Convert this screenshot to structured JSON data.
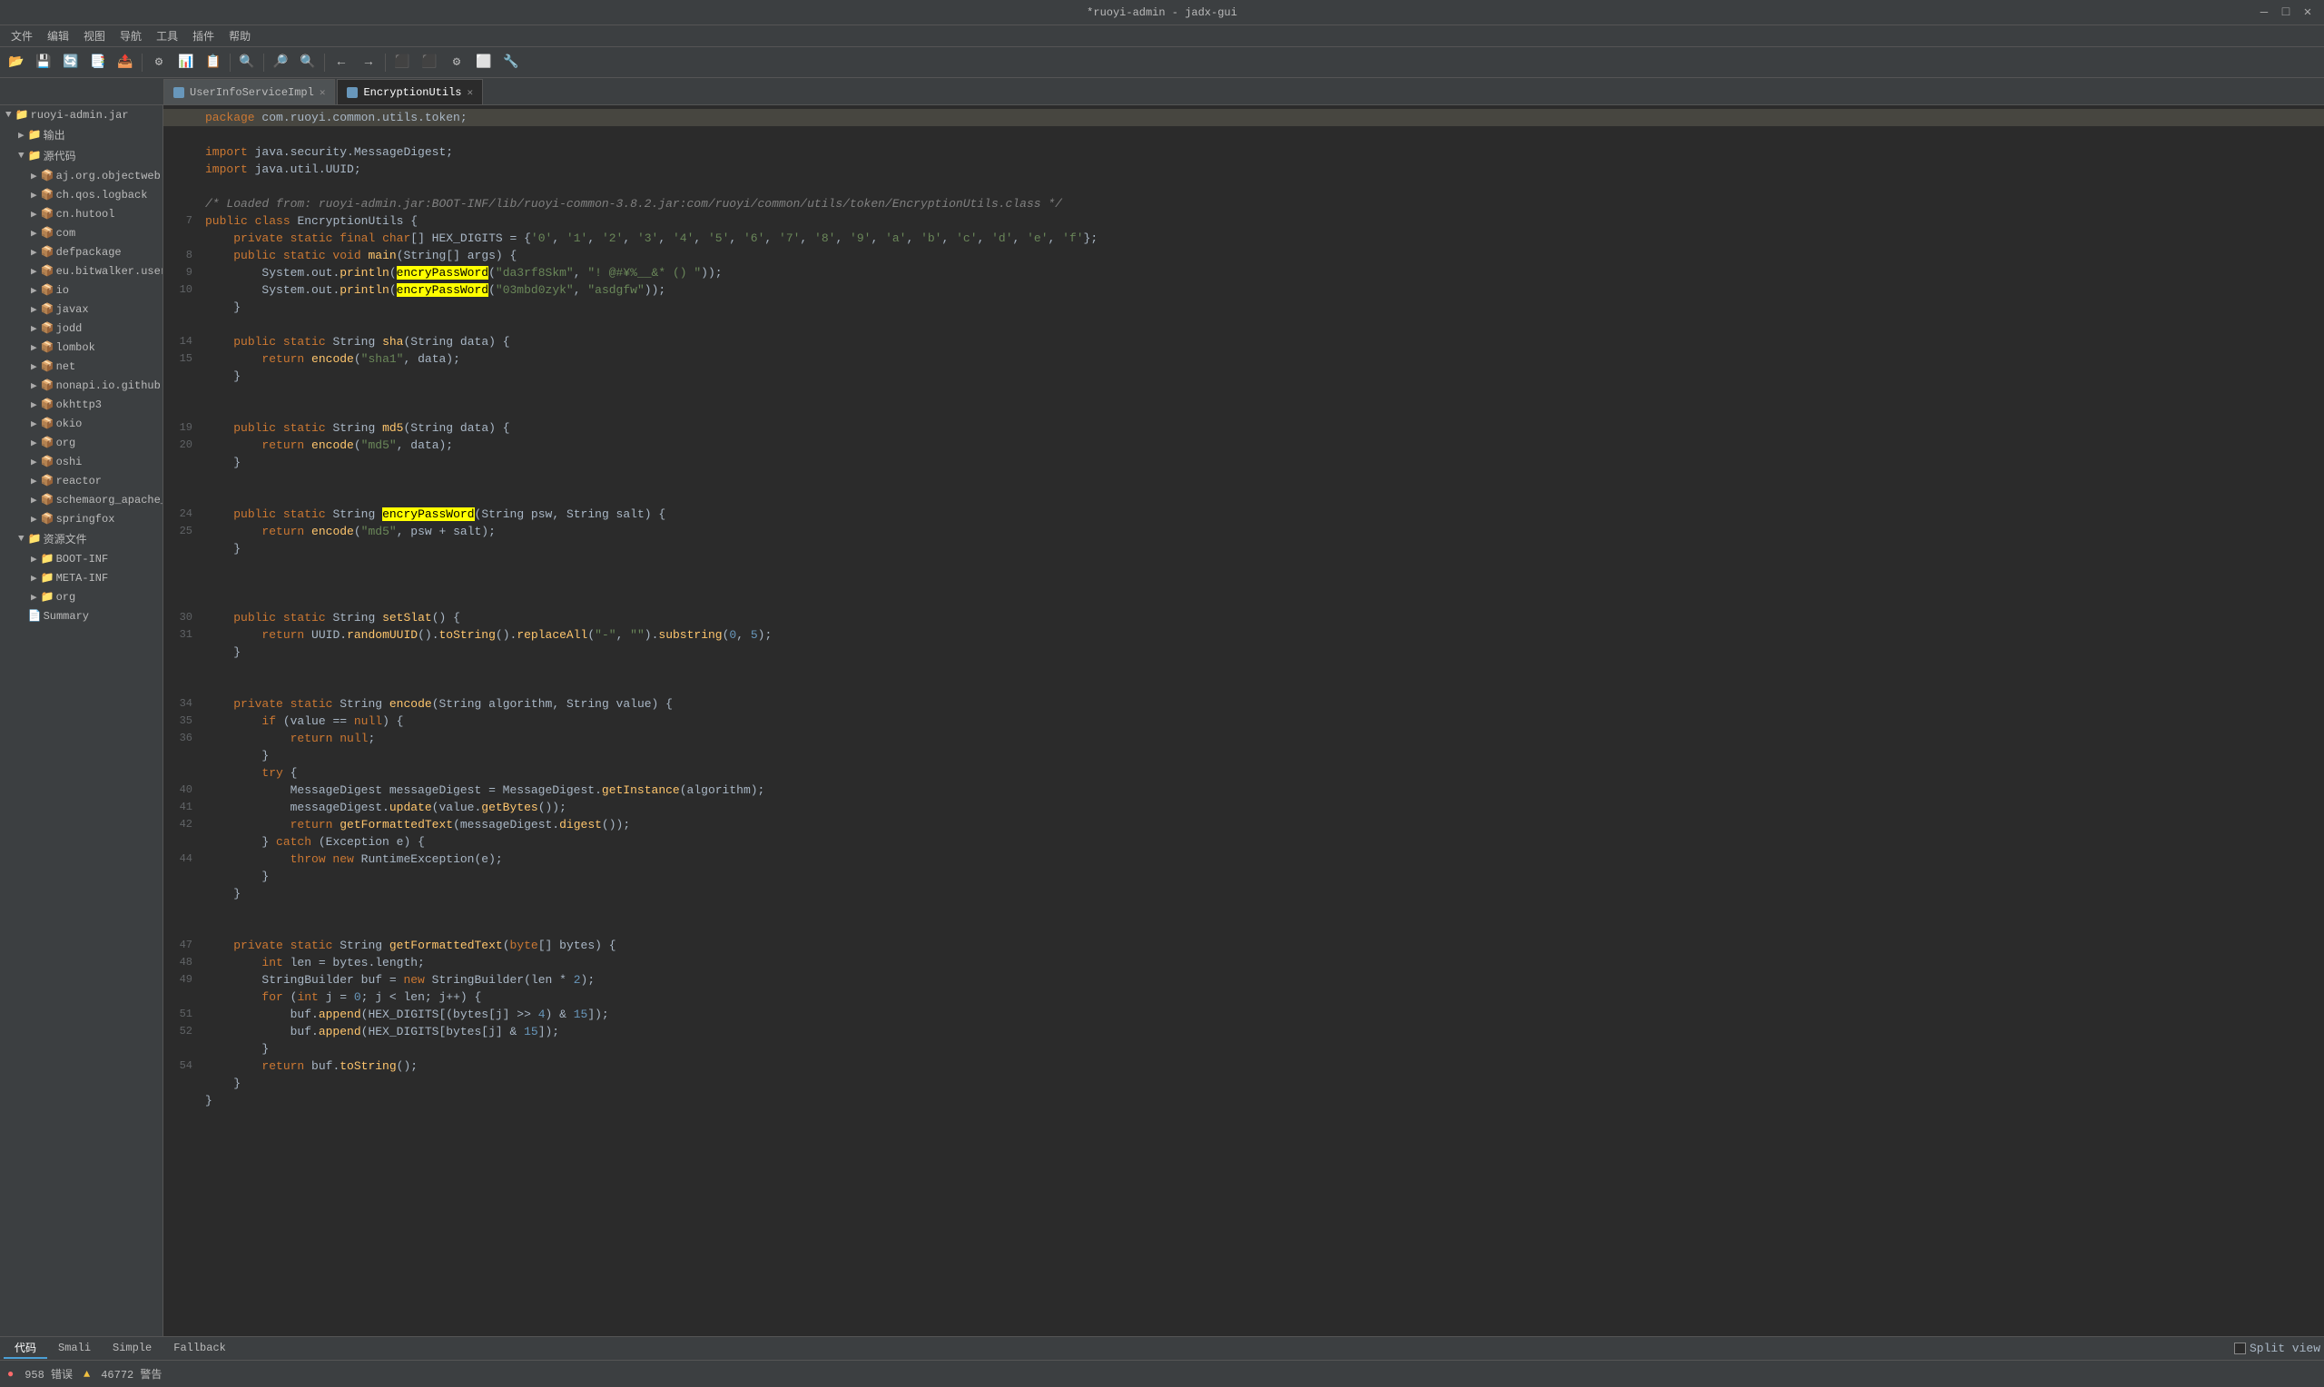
{
  "titlebar": {
    "title": "*ruoyi-admin - jadx-gui",
    "min": "—",
    "max": "□",
    "close": "✕"
  },
  "menubar": {
    "items": [
      "文件",
      "编辑",
      "视图",
      "导航",
      "工具",
      "插件",
      "帮助"
    ]
  },
  "tabs": [
    {
      "id": "userinfoserviceimpl",
      "label": "UserInfoServiceImpl",
      "icon_color": "#6897bb",
      "active": false
    },
    {
      "id": "encryptionutils",
      "label": "EncryptionUtils",
      "icon_color": "#6897bb",
      "active": true
    }
  ],
  "sidebar": {
    "title": "ruoyi-admin.jar",
    "items": [
      {
        "id": "output",
        "label": "输出",
        "level": 1,
        "expanded": false,
        "icon": "folder"
      },
      {
        "id": "sourcecode",
        "label": "源代码",
        "level": 1,
        "expanded": true,
        "icon": "folder"
      },
      {
        "id": "aj",
        "label": "aj.org.objectweb...",
        "level": 2,
        "expanded": false,
        "icon": "package"
      },
      {
        "id": "ch",
        "label": "ch.qos.logback",
        "level": 2,
        "expanded": false,
        "icon": "package"
      },
      {
        "id": "cn",
        "label": "cn.hutool",
        "level": 2,
        "expanded": false,
        "icon": "package"
      },
      {
        "id": "com",
        "label": "com",
        "level": 2,
        "expanded": false,
        "icon": "package"
      },
      {
        "id": "defpackage",
        "label": "defpackage",
        "level": 2,
        "expanded": false,
        "icon": "package"
      },
      {
        "id": "eu",
        "label": "eu.bitwalker.user...",
        "level": 2,
        "expanded": false,
        "icon": "package"
      },
      {
        "id": "io",
        "label": "io",
        "level": 2,
        "expanded": false,
        "icon": "package"
      },
      {
        "id": "javax",
        "label": "javax",
        "level": 2,
        "expanded": false,
        "icon": "package"
      },
      {
        "id": "jodd",
        "label": "jodd",
        "level": 2,
        "expanded": false,
        "icon": "package"
      },
      {
        "id": "lombok",
        "label": "lombok",
        "level": 2,
        "expanded": false,
        "icon": "package"
      },
      {
        "id": "net",
        "label": "net",
        "level": 2,
        "expanded": false,
        "icon": "package"
      },
      {
        "id": "nonapi",
        "label": "nonapi.io.github...",
        "level": 2,
        "expanded": false,
        "icon": "package"
      },
      {
        "id": "okhttp3",
        "label": "okhttp3",
        "level": 2,
        "expanded": false,
        "icon": "package"
      },
      {
        "id": "okio",
        "label": "okio",
        "level": 2,
        "expanded": false,
        "icon": "package"
      },
      {
        "id": "org",
        "label": "org",
        "level": 2,
        "expanded": false,
        "icon": "package"
      },
      {
        "id": "oshi",
        "label": "oshi",
        "level": 2,
        "expanded": false,
        "icon": "package"
      },
      {
        "id": "reactor",
        "label": "reactor",
        "level": 2,
        "expanded": false,
        "icon": "package"
      },
      {
        "id": "schemaorg",
        "label": "schemaorg_apache_...",
        "level": 2,
        "expanded": false,
        "icon": "package"
      },
      {
        "id": "springfox",
        "label": "springfox",
        "level": 2,
        "expanded": false,
        "icon": "package"
      },
      {
        "id": "resources",
        "label": "资源文件",
        "level": 1,
        "expanded": true,
        "icon": "folder"
      },
      {
        "id": "bootinf",
        "label": "BOOT-INF",
        "level": 2,
        "expanded": false,
        "icon": "folder"
      },
      {
        "id": "metainf",
        "label": "META-INF",
        "level": 2,
        "expanded": false,
        "icon": "folder"
      },
      {
        "id": "org2",
        "label": "org",
        "level": 2,
        "expanded": false,
        "icon": "folder"
      },
      {
        "id": "summary",
        "label": "Summary",
        "level": 1,
        "icon": "file"
      }
    ]
  },
  "code": {
    "package_line": "package com.ruoyi.common.utils.token;",
    "lines": [
      {
        "num": "",
        "content": ""
      },
      {
        "num": "",
        "content": ""
      },
      {
        "num": "",
        "content": ""
      },
      {
        "num": "",
        "content": ""
      },
      {
        "num": "",
        "content": ""
      },
      {
        "num": "",
        "content": ""
      },
      {
        "num": "7",
        "content": "public class EncryptionUtils {"
      },
      {
        "num": "",
        "content": "    private static final char[] HEX_DIGITS = {'0', '1', '2', '3', '4', '5', '6', '7', '8', '9', 'a', 'b', 'c', 'd', 'e', 'f'};"
      },
      {
        "num": "8",
        "content": "    public static void main(String[] args) {"
      },
      {
        "num": "9",
        "content": "        System.out.println(encryPassWord(\"da3rf8Skm\", \"! @#¥%__&* () \"));"
      },
      {
        "num": "10",
        "content": "        System.out.println(encryPassWord(\"03mbd0zyk\", \"asdgfw\"));"
      },
      {
        "num": "",
        "content": "    }"
      },
      {
        "num": "",
        "content": ""
      },
      {
        "num": "14",
        "content": "    public static String sha(String data) {"
      },
      {
        "num": "15",
        "content": "        return encode(\"sha1\", data);"
      },
      {
        "num": "",
        "content": "    }"
      },
      {
        "num": "",
        "content": ""
      },
      {
        "num": "",
        "content": ""
      },
      {
        "num": "19",
        "content": "    public static String md5(String data) {"
      },
      {
        "num": "20",
        "content": "        return encode(\"md5\", data);"
      },
      {
        "num": "",
        "content": "    }"
      },
      {
        "num": "",
        "content": ""
      },
      {
        "num": "",
        "content": ""
      },
      {
        "num": "24",
        "content": "    public static String encryPassWord(String psw, String salt) {"
      },
      {
        "num": "25",
        "content": "        return encode(\"md5\", psw + salt);"
      },
      {
        "num": "",
        "content": "    }"
      },
      {
        "num": "",
        "content": ""
      },
      {
        "num": "",
        "content": ""
      },
      {
        "num": "",
        "content": ""
      },
      {
        "num": "30",
        "content": "    public static String setSlat() {"
      },
      {
        "num": "31",
        "content": "        return UUID.randomUUID().toString().replaceAll(\"-\", \"\").substring(0, 5);"
      },
      {
        "num": "",
        "content": "    }"
      },
      {
        "num": "",
        "content": ""
      },
      {
        "num": "",
        "content": ""
      },
      {
        "num": "34",
        "content": "    private static String encode(String algorithm, String value) {"
      },
      {
        "num": "35",
        "content": "        if (value == null) {"
      },
      {
        "num": "36",
        "content": "            return null;"
      },
      {
        "num": "",
        "content": "        }"
      },
      {
        "num": "",
        "content": "        try {"
      },
      {
        "num": "40",
        "content": "            MessageDigest messageDigest = MessageDigest.getInstance(algorithm);"
      },
      {
        "num": "41",
        "content": "            messageDigest.update(value.getBytes());"
      },
      {
        "num": "42",
        "content": "            return getFormattedText(messageDigest.digest());"
      },
      {
        "num": "",
        "content": "        } catch (Exception e) {"
      },
      {
        "num": "44",
        "content": "            throw new RuntimeException(e);"
      },
      {
        "num": "",
        "content": "        }"
      },
      {
        "num": "",
        "content": "    }"
      },
      {
        "num": "",
        "content": ""
      },
      {
        "num": "",
        "content": ""
      },
      {
        "num": "47",
        "content": "    private static String getFormattedText(byte[] bytes) {"
      },
      {
        "num": "48",
        "content": "        int len = bytes.length;"
      },
      {
        "num": "49",
        "content": "        StringBuilder buf = new StringBuilder(len * 2);"
      },
      {
        "num": "",
        "content": "        for (int j = 0; j < len; j++) {"
      },
      {
        "num": "51",
        "content": "            buf.append(HEX_DIGITS[(bytes[j] >> 4) & 15]);"
      },
      {
        "num": "52",
        "content": "            buf.append(HEX_DIGITS[bytes[j] & 15]);"
      },
      {
        "num": "",
        "content": "        }"
      },
      {
        "num": "54",
        "content": "        return buf.toString();"
      },
      {
        "num": "",
        "content": "    }"
      },
      {
        "num": "",
        "content": "}"
      }
    ]
  },
  "bottom_tabs": {
    "items": [
      "代码",
      "Smali",
      "Simple",
      "Fallback"
    ],
    "active": "代码",
    "split_view_label": "Split view"
  },
  "statusbar": {
    "errors": "958 错误",
    "warnings": "46772 警告"
  }
}
